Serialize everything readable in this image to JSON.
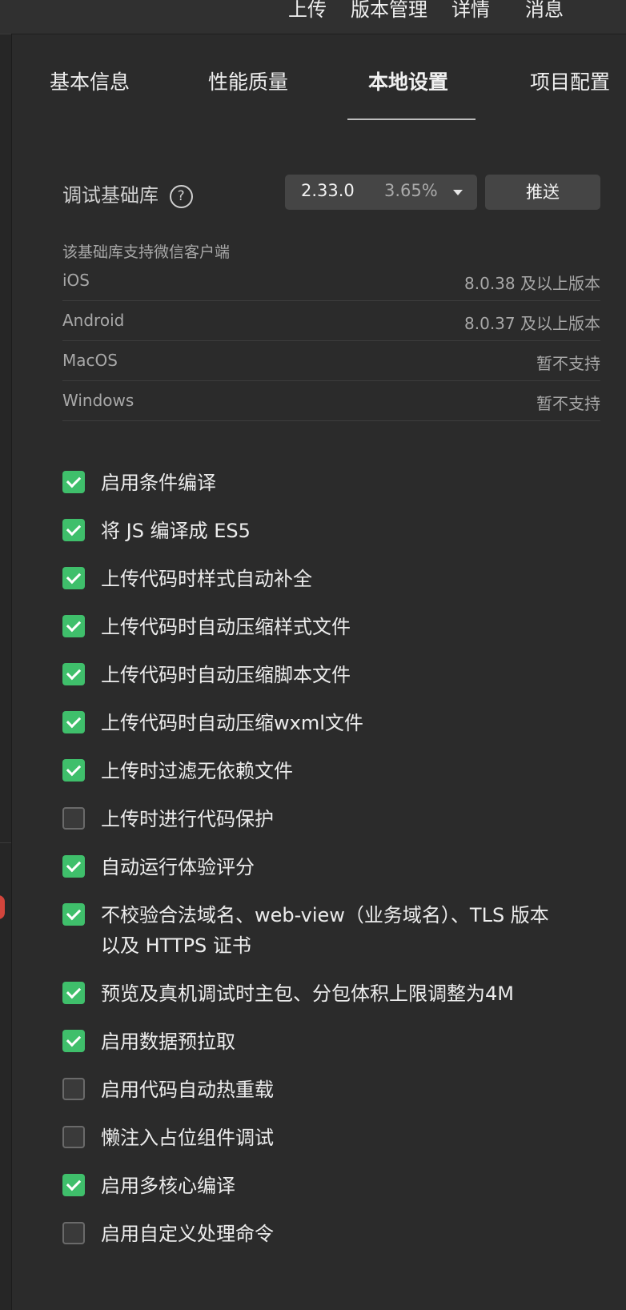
{
  "topbar": {
    "items": [
      "上传",
      "版本管理",
      "详情",
      "消息"
    ]
  },
  "tabs": [
    {
      "label": "基本信息",
      "active": false
    },
    {
      "label": "性能质量",
      "active": false
    },
    {
      "label": "本地设置",
      "active": true
    },
    {
      "label": "项目配置",
      "active": false
    }
  ],
  "debug_lib": {
    "label": "调试基础库",
    "help_icon": "question-circle-icon",
    "version": "2.33.0",
    "percentage": "3.65%",
    "push_label": "推送"
  },
  "support": {
    "title": "该基础库支持微信客户端",
    "rows": [
      {
        "platform": "iOS",
        "value": "8.0.38 及以上版本"
      },
      {
        "platform": "Android",
        "value": "8.0.37 及以上版本"
      },
      {
        "platform": "MacOS",
        "value": "暂不支持"
      },
      {
        "platform": "Windows",
        "value": "暂不支持"
      }
    ]
  },
  "options": [
    {
      "label": "启用条件编译",
      "checked": true
    },
    {
      "label": "将 JS 编译成 ES5",
      "checked": true
    },
    {
      "label": "上传代码时样式自动补全",
      "checked": true
    },
    {
      "label": "上传代码时自动压缩样式文件",
      "checked": true
    },
    {
      "label": "上传代码时自动压缩脚本文件",
      "checked": true
    },
    {
      "label": "上传代码时自动压缩wxml文件",
      "checked": true
    },
    {
      "label": "上传时过滤无依赖文件",
      "checked": true
    },
    {
      "label": "上传时进行代码保护",
      "checked": false
    },
    {
      "label": "自动运行体验评分",
      "checked": true
    },
    {
      "label": "不校验合法域名、web-view（业务域名）、TLS 版本以及 HTTPS 证书",
      "checked": true
    },
    {
      "label": "预览及真机调试时主包、分包体积上限调整为4M",
      "checked": true
    },
    {
      "label": "启用数据预拉取",
      "checked": true
    },
    {
      "label": "启用代码自动热重载",
      "checked": false
    },
    {
      "label": "懒注入占位组件调试",
      "checked": false
    },
    {
      "label": "启用多核心编译",
      "checked": true
    },
    {
      "label": "启用自定义处理命令",
      "checked": false
    }
  ],
  "colors": {
    "background": "#2b2b2b",
    "checkbox_on": "#3fbf6b",
    "button": "#454545"
  }
}
